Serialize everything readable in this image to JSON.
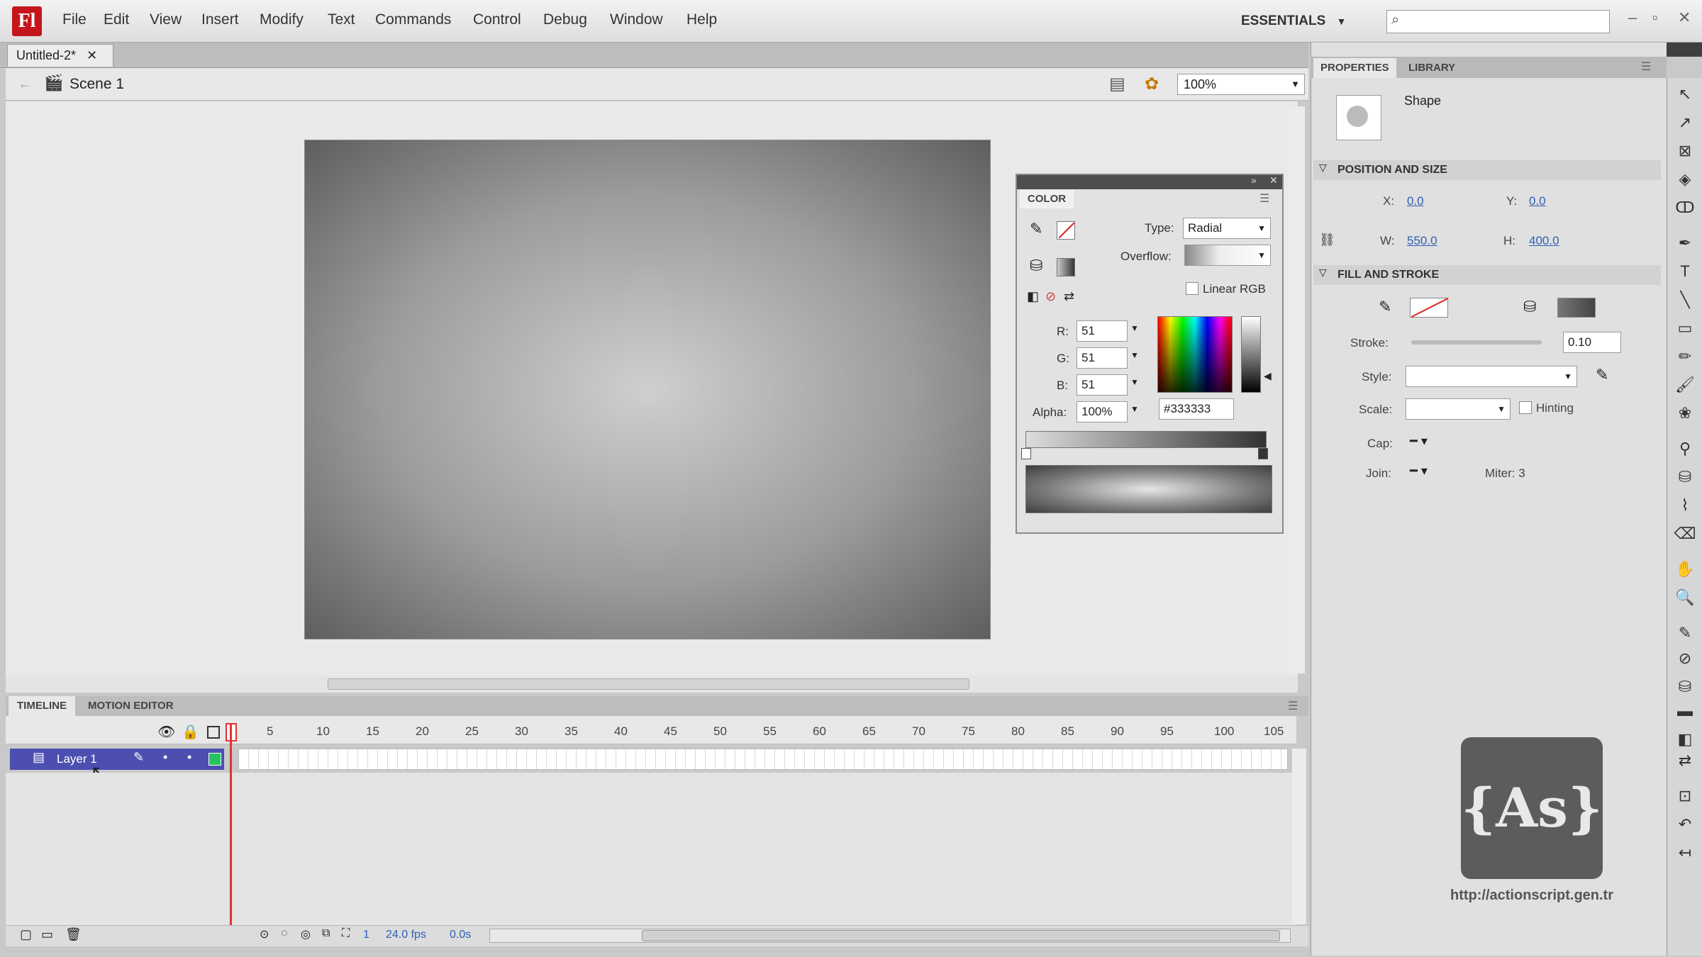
{
  "app": {
    "logo": "Fl"
  },
  "menu": [
    "File",
    "Edit",
    "View",
    "Insert",
    "Modify",
    "Text",
    "Commands",
    "Control",
    "Debug",
    "Window",
    "Help"
  ],
  "workspace": "ESSENTIALS",
  "document_tab": "Untitled-2*",
  "scene": "Scene 1",
  "zoom": "100%",
  "color_panel": {
    "tab": "COLOR",
    "type_label": "Type:",
    "type_value": "Radial",
    "overflow_label": "Overflow:",
    "linear_rgb": "Linear RGB",
    "r_label": "R:",
    "r": "51",
    "g_label": "G:",
    "g": "51",
    "b_label": "B:",
    "b": "51",
    "alpha_label": "Alpha:",
    "alpha": "100%",
    "hex": "#333333"
  },
  "properties": {
    "tabs": [
      "PROPERTIES",
      "LIBRARY"
    ],
    "object_type": "Shape",
    "position_section": "POSITION AND SIZE",
    "x_label": "X:",
    "x": "0.0",
    "y_label": "Y:",
    "y": "0.0",
    "w_label": "W:",
    "w": "550.0",
    "h_label": "H:",
    "h": "400.0",
    "fill_section": "FILL AND STROKE",
    "stroke_label": "Stroke:",
    "stroke": "0.10",
    "style_label": "Style:",
    "scale_label": "Scale:",
    "hinting": "Hinting",
    "cap_label": "Cap:",
    "join_label": "Join:",
    "miter": "Miter: 3"
  },
  "timeline": {
    "tabs": [
      "TIMELINE",
      "MOTION EDITOR"
    ],
    "layer": "Layer 1",
    "frames": [
      "1",
      "5",
      "10",
      "15",
      "20",
      "25",
      "30",
      "35",
      "40",
      "45",
      "50",
      "55",
      "60",
      "65",
      "70",
      "75",
      "80",
      "85",
      "90",
      "95",
      "100",
      "105"
    ],
    "fps": "24.0 fps",
    "time": "0.0s",
    "current_frame": "1"
  },
  "branding": {
    "logo": "{As}",
    "url": "http://actionscript.gen.tr"
  },
  "colors": {
    "accent": "#4c4fb0",
    "playhead": "#e23232",
    "app_red": "#c4161c"
  }
}
